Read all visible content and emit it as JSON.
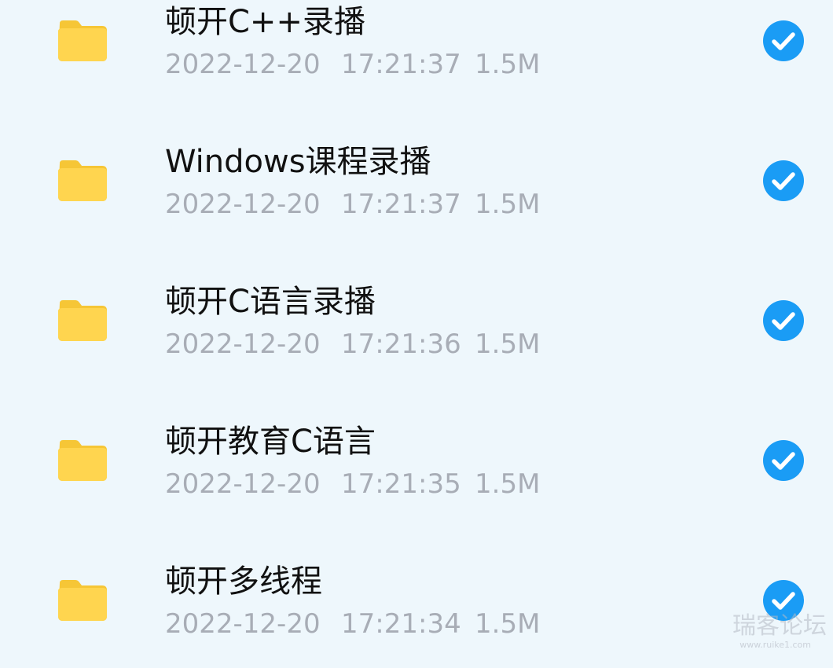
{
  "files": [
    {
      "name": "顿开C++录播",
      "date": "2022-12-20",
      "time": "17:21:37",
      "size": "1.5M",
      "icon": "folder-icon",
      "selected": true
    },
    {
      "name": "Windows课程录播",
      "date": "2022-12-20",
      "time": "17:21:37",
      "size": "1.5M",
      "icon": "folder-icon",
      "selected": true
    },
    {
      "name": "顿开C语言录播",
      "date": "2022-12-20",
      "time": "17:21:36",
      "size": "1.5M",
      "icon": "folder-icon",
      "selected": true
    },
    {
      "name": "顿开教育C语言",
      "date": "2022-12-20",
      "time": "17:21:35",
      "size": "1.5M",
      "icon": "folder-icon",
      "selected": true
    },
    {
      "name": "顿开多线程",
      "date": "2022-12-20",
      "time": "17:21:34",
      "size": "1.5M",
      "icon": "folder-icon",
      "selected": true
    }
  ],
  "watermark": {
    "text": "瑞客论坛",
    "subtext": "www.ruike1.com"
  },
  "colors": {
    "background": "#eef7fc",
    "folder": "#ffd54f",
    "folder_tab": "#f6c636",
    "check": "#1a9cf5",
    "meta_text": "#a8adb6",
    "name_text": "#111111"
  }
}
